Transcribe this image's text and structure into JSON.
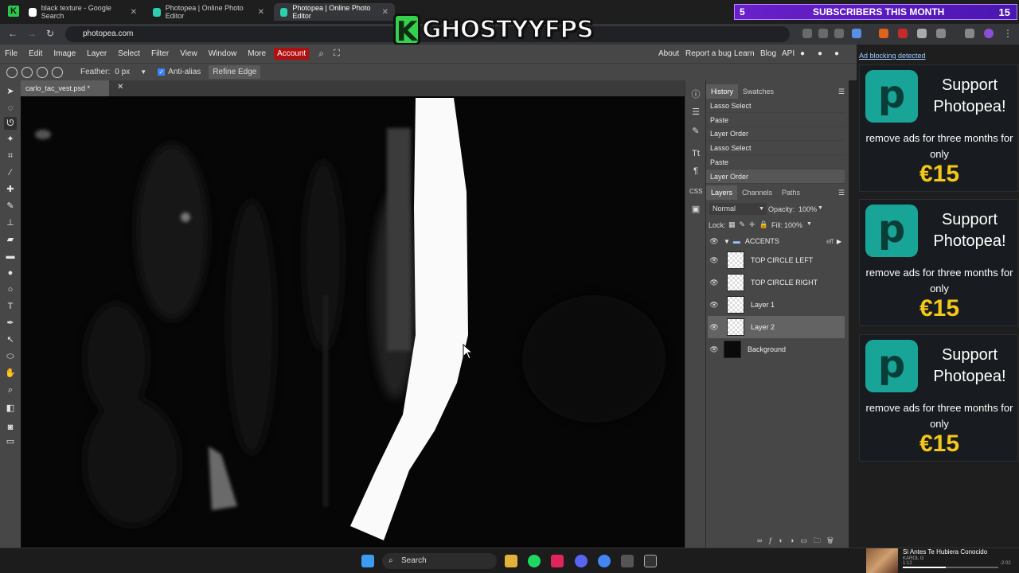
{
  "browser": {
    "tabs": [
      {
        "title": "black texture - Google Search"
      },
      {
        "title": "Photopea | Online Photo Editor"
      },
      {
        "title": "Photopea | Online Photo Editor"
      }
    ],
    "url": "photopea.com"
  },
  "overlay": {
    "streamer_logo": "K",
    "streamer_name": "GHOSTYYFPS",
    "subs_left": "5",
    "subs_text": "SUBSCRIBERS THIS MONTH",
    "subs_right": "15"
  },
  "menubar": {
    "items": [
      "File",
      "Edit",
      "Image",
      "Layer",
      "Select",
      "Filter",
      "View",
      "Window",
      "More"
    ],
    "account": "Account",
    "right": [
      "About",
      "Report a bug",
      "Learn",
      "Blog",
      "API"
    ]
  },
  "options": {
    "feather_label": "Feather:",
    "feather_value": "0 px",
    "antialias_label": "Anti-alias",
    "antialias_checked": true,
    "refine": "Refine Edge"
  },
  "document": {
    "tab_title": "carlo_tac_vest.psd *"
  },
  "history": {
    "tabs": [
      "History",
      "Swatches"
    ],
    "items": [
      "Lasso Select",
      "Paste",
      "Layer Order",
      "Lasso Select",
      "Paste",
      "Layer Order"
    ]
  },
  "layers_panel": {
    "tabs": [
      "Layers",
      "Channels",
      "Paths"
    ],
    "blend_mode": "Normal",
    "opacity_label": "Opacity:",
    "opacity_value": "100%",
    "lock_label": "Lock:",
    "fill_label": "Fill:",
    "fill_value": "100%",
    "fx_label": "eff",
    "group": "ACCENTS",
    "layers": [
      "TOP CIRCLE LEFT",
      "TOP CIRCLE RIGHT",
      "Layer 1",
      "Layer 2",
      "Background"
    ],
    "selected": "Layer 2"
  },
  "ads": {
    "notice": "Ad blocking detected",
    "headline": "Support Photopea!",
    "subtext": "remove ads for three months for only",
    "price": "€15"
  },
  "taskbar": {
    "search": "Search",
    "media_title": "Si Antes Te Hubiera Conocido",
    "media_artist": "KAROL G",
    "media_elapsed": "1:12",
    "media_total": "-2:02",
    "media_progress": 0.45
  }
}
